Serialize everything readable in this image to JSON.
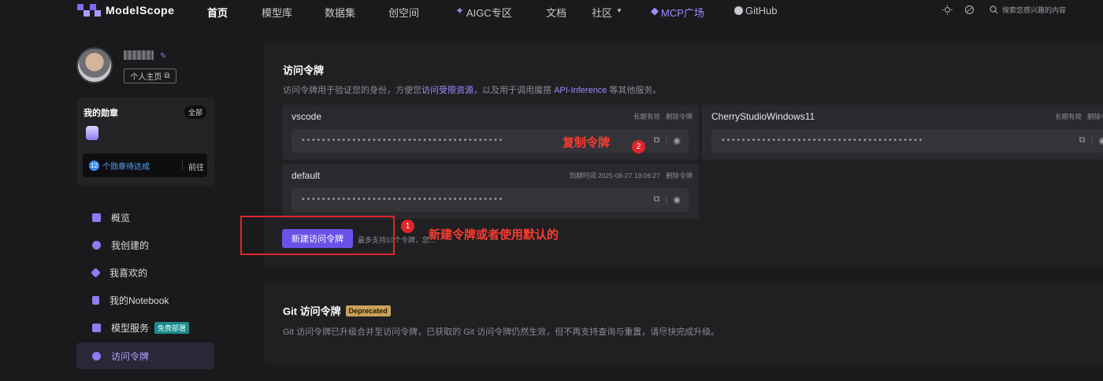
{
  "nav": {
    "logo_text": "ModelScope",
    "items": [
      "首页",
      "模型库",
      "数据集",
      "创空间",
      "AIGC专区",
      "文档",
      "社区",
      "MCP广场",
      "GitHub"
    ],
    "search_placeholder": "搜索您感兴趣的内容",
    "colors": {
      "accent": "#7b6cf6",
      "mcp": "#9c8cff"
    }
  },
  "profile": {
    "homepage_label": "个人主页"
  },
  "badges": {
    "title": "我的勋章",
    "all_label": "全部",
    "count": "12",
    "pending_text": "个勋章待达成",
    "go_label": "前往"
  },
  "sidebar": {
    "items": [
      {
        "label": "概览",
        "icon": "home-icon"
      },
      {
        "label": "我创建的",
        "icon": "create-icon"
      },
      {
        "label": "我喜欢的",
        "icon": "heart-icon"
      },
      {
        "label": "我的Notebook",
        "icon": "notebook-icon"
      },
      {
        "label": "模型服务",
        "icon": "cube-icon",
        "tag": "免费部署"
      },
      {
        "label": "访问令牌",
        "icon": "key-icon",
        "active": true
      }
    ]
  },
  "access_tokens": {
    "title": "访问令牌",
    "desc_prefix": "访问令牌用于验证您的身份，方便您",
    "desc_link1": "访问受限资源",
    "desc_mid": "，以及用于调用魔搭 ",
    "desc_link2": "API-Inference",
    "desc_suffix": " 等其他服务。",
    "tokens": [
      {
        "name": "vscode",
        "validity": "长期有效",
        "delete": "删除令牌",
        "masked": "••••••••••••••••••••••••••••••••••••••••"
      },
      {
        "name": "CherryStudioWindows11",
        "validity": "长期有效",
        "delete": "删除令牌",
        "masked": "••••••••••••••••••••••••••••••••••••••••"
      },
      {
        "name": "default",
        "validity": "到期时间 2025-08-27 19:06:27",
        "delete": "删除令牌",
        "masked": "••••••••••••••••••••••••••••••••••••••••"
      }
    ],
    "new_button": "新建访问令牌",
    "hint": "最多支持10个令牌，您..."
  },
  "git_tokens": {
    "title": "Git 访问令牌",
    "tag": "Deprecated",
    "desc": "Git 访问令牌已升级合并至访问令牌，已获取的 Git 访问令牌仍然生效，但不再支持查询与重置，请尽快完成升级。"
  },
  "annotations": {
    "step1_number": "1",
    "step1_text": "新建令牌或者使用默认的",
    "step2_number": "2",
    "step2_text": "复制令牌"
  }
}
